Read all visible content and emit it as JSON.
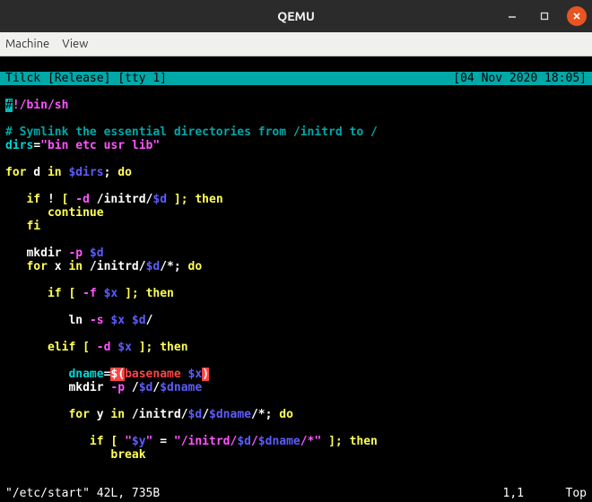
{
  "window": {
    "title": "QEMU"
  },
  "menubar": {
    "items": [
      "Machine",
      "View"
    ]
  },
  "statusbar": {
    "left": "Tilck [Release] [tty 1]",
    "right": "[04 Nov 2020 18:05]"
  },
  "code": {
    "shebang_hash": "#",
    "shebang_rest": "!/bin/sh",
    "comment": "# Symlink the essential directories from /initrd to /",
    "dirs_assign_lhs": "dirs",
    "dirs_assign_eq": "=",
    "dirs_assign_val": "\"bin etc usr lib\"",
    "for_kw": "for",
    "d_var": " d ",
    "in_kw": "in",
    "dirs_ref": " $dirs",
    "semi_do": "; ",
    "do_kw": "do",
    "if_kw": "if",
    "neg": " ! ",
    "lb": "[ ",
    "test_d": "-d",
    "path_initrd": " /initrd/",
    "d_ref": "$d",
    "rb_then": " ]; ",
    "then_kw": "then",
    "continue_kw": "continue",
    "fi_kw": "fi",
    "mkdir": "mkdir ",
    "mkdir_p": "-p",
    "sp_d": " $d",
    "for2_x": " x ",
    "path_initrd2": " /initrd/",
    "glob": "/*; ",
    "test_f": "-f",
    "x_ref": " $x",
    "ln": "ln ",
    "ln_s": "-s",
    "x_ref2": " $x",
    "d_ref2": " $d",
    "slash": "/",
    "elif_kw": "elif",
    "dname_lhs": "dname",
    "eq": "=",
    "subst_open": "$(",
    "basename": "basename ",
    "x_ref3": "$x",
    "subst_close": ")",
    "mkdir2_path": " /",
    "d_ref3": "$d",
    "slash2": "/",
    "dname_ref": "$dname",
    "for3_y": " y ",
    "path_initrd3": " /initrd/",
    "glob2": "/*; ",
    "quote": "\"",
    "y_ref": "$y",
    "eq_test": " = ",
    "path_initrd4": "/initrd/",
    "star": "/*",
    "break_kw": "break"
  },
  "footer": {
    "left": "\"/etc/start\" 42L, 735B",
    "mid": "1,1",
    "right": "Top"
  }
}
